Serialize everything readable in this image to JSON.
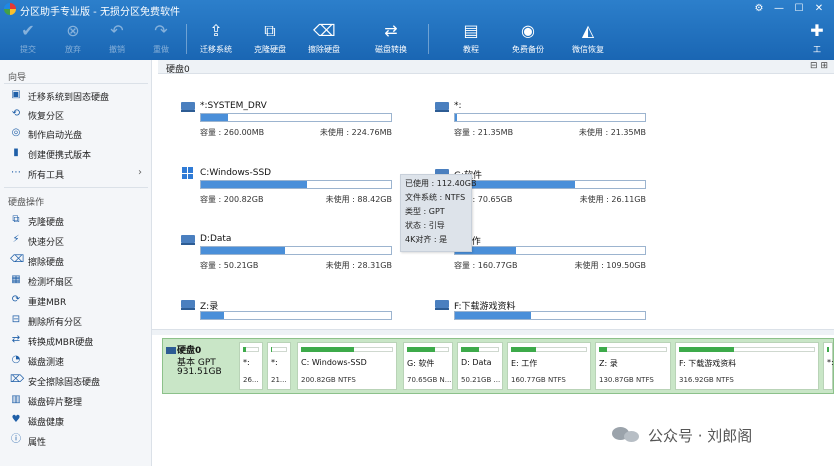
{
  "window": {
    "title": "分区助手专业版 - 无损分区免费软件",
    "controls": {
      "settings": "⚙",
      "minimize": "—",
      "maximize": "☐",
      "close": "✕"
    }
  },
  "toolbar": {
    "buttons": [
      {
        "label": "提交",
        "icon": "check-icon",
        "glyph": "✔",
        "enabled": false
      },
      {
        "label": "放弃",
        "icon": "cancel-icon",
        "glyph": "⊗",
        "enabled": false
      },
      {
        "label": "撤销",
        "icon": "undo-icon",
        "glyph": "↶",
        "enabled": false
      },
      {
        "label": "重做",
        "icon": "redo-icon",
        "glyph": "↷",
        "enabled": false
      },
      {
        "label": "迁移系统",
        "icon": "migrate-os-icon",
        "glyph": "⇪",
        "enabled": true
      },
      {
        "label": "克隆硬盘",
        "icon": "clone-disk-icon",
        "glyph": "⧉",
        "enabled": true
      },
      {
        "label": "擦除硬盘",
        "icon": "wipe-disk-icon",
        "glyph": "⌫",
        "enabled": true
      },
      {
        "label": "磁盘转换",
        "icon": "convert-disk-icon",
        "glyph": "⇄",
        "enabled": true
      },
      {
        "label": "教程",
        "icon": "tutorial-icon",
        "glyph": "▤",
        "enabled": true
      },
      {
        "label": "免费备份",
        "icon": "free-backup-icon",
        "glyph": "◉",
        "enabled": true
      },
      {
        "label": "微信恢复",
        "icon": "wechat-recovery-icon",
        "glyph": "◭",
        "enabled": true
      },
      {
        "label": "工",
        "icon": "tools-icon",
        "glyph": "✚",
        "enabled": true
      }
    ]
  },
  "sidebar": {
    "guide_title": "向导",
    "guide_items": [
      {
        "label": "迁移系统到固态硬盘",
        "icon": "migrate-icon",
        "glyph": "▣"
      },
      {
        "label": "恢复分区",
        "icon": "restore-partition-icon",
        "glyph": "⟲"
      },
      {
        "label": "制作启动光盘",
        "icon": "bootable-media-icon",
        "glyph": "◎"
      },
      {
        "label": "创建便携式版本",
        "icon": "portable-version-icon",
        "glyph": "▮"
      },
      {
        "label": "所有工具",
        "icon": "all-tools-icon",
        "glyph": "⋯",
        "arrow": "›"
      }
    ],
    "disk_ops_title": "硬盘操作",
    "disk_ops_items": [
      {
        "label": "克隆硬盘",
        "icon": "clone-icon",
        "glyph": "⧉"
      },
      {
        "label": "快速分区",
        "icon": "quick-partition-icon",
        "glyph": "⚡"
      },
      {
        "label": "擦除硬盘",
        "icon": "wipe-icon",
        "glyph": "⌫"
      },
      {
        "label": "检测坏扇区",
        "icon": "bad-sector-icon",
        "glyph": "▦"
      },
      {
        "label": "重建MBR",
        "icon": "rebuild-mbr-icon",
        "glyph": "⟳"
      },
      {
        "label": "删除所有分区",
        "icon": "delete-all-icon",
        "glyph": "⊟"
      },
      {
        "label": "转换成MBR硬盘",
        "icon": "convert-mbr-icon",
        "glyph": "⇄"
      },
      {
        "label": "磁盘测速",
        "icon": "disk-speed-icon",
        "glyph": "◔"
      },
      {
        "label": "安全擦除固态硬盘",
        "icon": "secure-erase-icon",
        "glyph": "⌦"
      },
      {
        "label": "磁盘碎片整理",
        "icon": "defrag-icon",
        "glyph": "▥"
      },
      {
        "label": "磁盘健康",
        "icon": "disk-health-icon",
        "glyph": "♥"
      },
      {
        "label": "属性",
        "icon": "properties-icon",
        "glyph": "ⓘ"
      }
    ]
  },
  "disk_header": {
    "label": "硬盘0",
    "controls": "⊟ ⊞"
  },
  "partitions": [
    {
      "name": "*:SYSTEM_DRV",
      "os": false,
      "used_fraction": 0.14,
      "capacity": "容量 : 260.00MB",
      "free": "未使用 : 224.76MB"
    },
    {
      "name": "*:",
      "os": false,
      "used_fraction": 0.01,
      "capacity": "容量 : 21.35MB",
      "free": "未使用 : 21.35MB"
    },
    {
      "name": "C:Windows-SSD",
      "os": true,
      "used_fraction": 0.56,
      "capacity": "容量 : 200.82GB",
      "free": "未使用 : 88.42GB"
    },
    {
      "name": "G:软件",
      "os": false,
      "used_fraction": 0.63,
      "capacity": "容量 : 70.65GB",
      "free": "未使用 : 26.11GB"
    },
    {
      "name": "D:Data",
      "os": false,
      "used_fraction": 0.44,
      "capacity": "容量 : 50.21GB",
      "free": "未使用 : 28.31GB"
    },
    {
      "name": "E:工作",
      "os": false,
      "used_fraction": 0.32,
      "capacity": "容量 : 160.77GB",
      "free": "未使用 : 109.50GB"
    },
    {
      "name": "Z:录",
      "os": false,
      "used_fraction": 0.12,
      "capacity": "",
      "free": ""
    },
    {
      "name": "F:下载游戏资料",
      "os": false,
      "used_fraction": 0.4,
      "capacity": "",
      "free": ""
    }
  ],
  "tooltip": {
    "lines": [
      "已使用 : 112.40GB",
      "文件系统 : NTFS",
      "类型 : GPT",
      "状态 : 引导",
      "4K对齐 : 是"
    ]
  },
  "disk_strip": {
    "summary": {
      "name": "硬盘0",
      "type": "基本 GPT",
      "size": "931.51GB"
    },
    "parts": [
      {
        "name": "*:",
        "size": "26...",
        "used_fraction": 0.15
      },
      {
        "name": "*:",
        "size": "21...",
        "used_fraction": 0.05
      },
      {
        "name": "C: Windows-SSD",
        "size": "200.82GB NTFS",
        "used_fraction": 0.56
      },
      {
        "name": "G: 软件",
        "size": "70.65GB N...",
        "used_fraction": 0.63
      },
      {
        "name": "D: Data",
        "size": "50.21GB ...",
        "used_fraction": 0.44
      },
      {
        "name": "E: 工作",
        "size": "160.77GB NTFS",
        "used_fraction": 0.32
      },
      {
        "name": "Z: 录",
        "size": "130.87GB NTFS",
        "used_fraction": 0.12
      },
      {
        "name": "F: 下载游戏资料",
        "size": "316.92GB NTFS",
        "used_fraction": 0.4
      },
      {
        "name": "*:",
        "size": "",
        "used_fraction": 0.3
      }
    ]
  },
  "watermark": {
    "text": "公众号 · 刘郎阁"
  }
}
